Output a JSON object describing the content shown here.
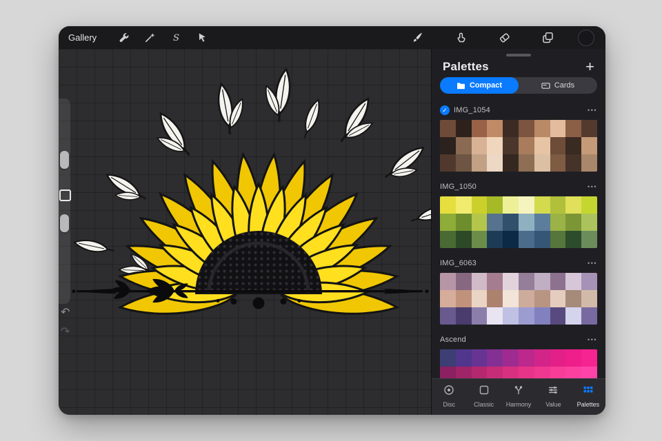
{
  "topbar": {
    "gallery_label": "Gallery",
    "tools_left": [
      "actions-wrench",
      "adjustments-wand",
      "selection-s",
      "transform-arrow"
    ],
    "tools_right": [
      "brush",
      "smudge",
      "eraser",
      "layers",
      "active-color"
    ],
    "current_color": "#17171b"
  },
  "icons": {
    "plus": "+",
    "options": "•••",
    "check": "✓",
    "undo": "↶",
    "redo": "↷"
  },
  "colors": {
    "accent": "#0a7aff"
  },
  "palettes_panel": {
    "title": "Palettes",
    "segmented": {
      "compact": "Compact",
      "cards": "Cards",
      "selected": "Compact"
    },
    "palettes": [
      {
        "name": "IMG_1054",
        "selected": true,
        "rows": [
          [
            "#6e4a38",
            "#2e211c",
            "#996248",
            "#c08a66",
            "#3c2b24",
            "#7c5440",
            "#ba8a66",
            "#e2bc9c",
            "#8a5f46",
            "#543a2e"
          ],
          [
            "#2b211d",
            "#8a6a52",
            "#d8b294",
            "#f0d6bc",
            "#4a362b",
            "#a87c5c",
            "#e6c4a4",
            "#6d4c38",
            "#392a22",
            "#c49a78"
          ],
          [
            "#50392c",
            "#6e5442",
            "#c2a084",
            "#ecd8c4",
            "#352821",
            "#8e6e54",
            "#dcc0a4",
            "#7e5c44",
            "#453228",
            "#a8876a"
          ]
        ]
      },
      {
        "name": "IMG_1050",
        "selected": false,
        "rows": [
          [
            "#e6de3e",
            "#f2ec6e",
            "#ccd02c",
            "#a6ba28",
            "#eef098",
            "#f6f4be",
            "#d4da4e",
            "#b0c03a",
            "#e0e05a",
            "#c6d630"
          ],
          [
            "#8eac38",
            "#6e8e2e",
            "#b4c64c",
            "#56728c",
            "#30506c",
            "#8eb0c0",
            "#5c7e9c",
            "#9ab246",
            "#7c9636",
            "#acc25c"
          ],
          [
            "#4a6a34",
            "#2c4a26",
            "#6c8c4a",
            "#1c3c56",
            "#0c2a46",
            "#4c6c8c",
            "#365678",
            "#56763c",
            "#2c4c2c",
            "#6c8c5c"
          ]
        ]
      },
      {
        "name": "IMG_6063",
        "selected": false,
        "rows": [
          [
            "#b696a6",
            "#886880",
            "#d0bac8",
            "#a67c90",
            "#e2d2dc",
            "#957e9a",
            "#c0aec2",
            "#8c728e",
            "#d6c6d8",
            "#a692b6"
          ],
          [
            "#d6ac9a",
            "#c0927c",
            "#ead4c4",
            "#ac826e",
            "#f2e4d8",
            "#cdac9c",
            "#b89482",
            "#e4ccbe",
            "#a68a7a",
            "#d2baaa"
          ],
          [
            "#685a8e",
            "#4a3c6c",
            "#8c7eaa",
            "#e8e4f2",
            "#c0c0e4",
            "#9c9cd0",
            "#8181c0",
            "#584a7e",
            "#d4d4ec",
            "#786aa0"
          ]
        ]
      },
      {
        "name": "Ascend",
        "selected": false,
        "rows": [
          [
            "#3c3e74",
            "#50368c",
            "#683494",
            "#842f93",
            "#a02b90",
            "#bc288c",
            "#d22489",
            "#e22088",
            "#ee1e8a",
            "#f62490"
          ],
          [
            "#8c2060",
            "#a02468",
            "#b42870",
            "#c62c78",
            "#d83080",
            "#e63488",
            "#f03890",
            "#f83c98",
            "#fc40a0",
            "#fe44a8"
          ],
          [
            "#5c1440",
            "#701848",
            "#841c50",
            "#982058",
            "#ac2460",
            "#c02868",
            "#d42c70",
            "#e83078",
            "#f43480",
            "#fc3888"
          ]
        ]
      }
    ],
    "tabs": [
      {
        "label": "Disc",
        "selected": false
      },
      {
        "label": "Classic",
        "selected": false
      },
      {
        "label": "Harmony",
        "selected": false
      },
      {
        "label": "Value",
        "selected": false
      },
      {
        "label": "Palettes",
        "selected": true
      }
    ]
  }
}
